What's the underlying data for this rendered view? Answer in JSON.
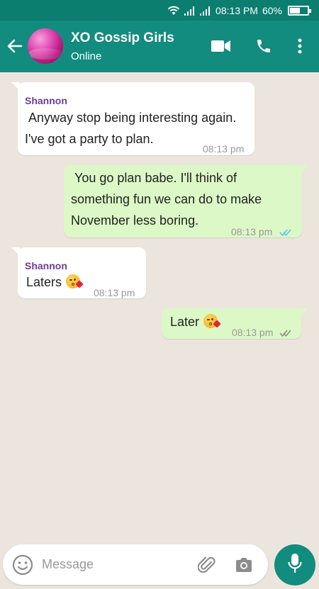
{
  "status_bar": {
    "time": "08:13 PM",
    "battery": "60%",
    "battery_level": 0.6,
    "icons": [
      "wifi-icon",
      "signal-icon",
      "signal-icon",
      "battery-icon"
    ]
  },
  "header": {
    "title": "XO Gossip Girls",
    "subtitle": "Online",
    "icons": [
      "back-arrow-icon",
      "avatar",
      "video-call-icon",
      "phone-icon",
      "more-vert-icon"
    ]
  },
  "messages": [
    {
      "direction": "in",
      "sender": "Shannon",
      "lines": [
        " Anyway stop being interesting again.",
        "I've got a party to plan."
      ],
      "time": "08:13 pm"
    },
    {
      "direction": "out",
      "lines": [
        " You go plan babe. I'll think of",
        "something fun we can do to make",
        "November less boring."
      ],
      "time": "08:13 pm",
      "ticks": "double-check-read",
      "tick_color": "#4fc3f7"
    },
    {
      "direction": "in",
      "sender": "Shannon",
      "lines": [
        "Laters"
      ],
      "emoji": "face-blowing-kiss",
      "time": "08:13 pm"
    },
    {
      "direction": "out",
      "lines": [
        "Later"
      ],
      "emoji": "face-blowing-kiss",
      "time": "08:13 pm",
      "ticks": "double-check-delivered",
      "tick_color": "#8a8a8a"
    }
  ],
  "input": {
    "placeholder": "Message",
    "value": ""
  },
  "colors": {
    "header": "#128c7e",
    "status_bar": "#0b7e70",
    "outgoing_bubble": "#dcf8c6",
    "incoming_bubble": "#ffffff",
    "sender_name": "#6a3d9a",
    "background": "#ece5dd"
  }
}
